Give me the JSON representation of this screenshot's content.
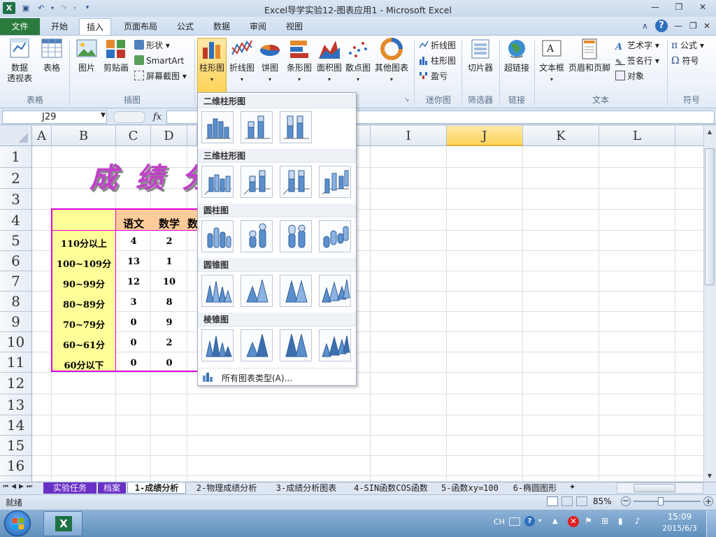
{
  "window": {
    "title": "Excel导学实验12-图表应用1 - Microsoft Excel"
  },
  "tabs": [
    "文件",
    "开始",
    "插入",
    "页面布局",
    "公式",
    "数据",
    "审阅",
    "视图"
  ],
  "ribbon": {
    "groups": {
      "table": {
        "label": "表格",
        "pivot_line1": "数据",
        "pivot_line2": "透视表",
        "table": "表格"
      },
      "illustrations": {
        "label": "插图",
        "picture": "图片",
        "clipart": "剪贴画",
        "shapes": "形状",
        "smartart": "SmartArt",
        "screenshot": "屏幕截图"
      },
      "charts": {
        "label": "",
        "column": "柱形图",
        "line": "折线图",
        "pie": "饼图",
        "bar": "条形图",
        "area": "面积图",
        "scatter": "散点图",
        "other": "其他图表"
      },
      "sparklines": {
        "label": "迷你图",
        "line": "折线图",
        "column": "柱形图",
        "winloss": "盈亏"
      },
      "filter": {
        "label": "筛选器",
        "slicer": "切片器"
      },
      "links": {
        "label": "链接",
        "hyperlink": "超链接"
      },
      "text": {
        "label": "文本",
        "textbox": "文本框",
        "headerfooter": "页眉和页脚",
        "wordart": "艺术字",
        "signature": "签名行",
        "object": "对象"
      },
      "symbols": {
        "label": "符号",
        "equation": "公式",
        "symbol": "符号"
      }
    }
  },
  "formula_bar": {
    "name_box": "J29",
    "fx": "fx",
    "value": ""
  },
  "columns": [
    "A",
    "B",
    "C",
    "D",
    "",
    "",
    "",
    "",
    "",
    "I",
    "J",
    "K",
    "L"
  ],
  "rows": [
    "1",
    "2",
    "3",
    "4",
    "5",
    "6",
    "7",
    "8",
    "9",
    "10",
    "11",
    "12",
    "13",
    "14",
    "15",
    "16"
  ],
  "sheet": {
    "title_art": "成 绩 分",
    "headers": [
      "语文",
      "数学",
      "数"
    ],
    "table": [
      {
        "label": "110分以上",
        "c": "4",
        "d": "2"
      },
      {
        "label": "100~109分",
        "c": "13",
        "d": "1"
      },
      {
        "label": "90~99分",
        "c": "12",
        "d": "10"
      },
      {
        "label": "80~89分",
        "c": "3",
        "d": "8"
      },
      {
        "label": "70~79分",
        "c": "0",
        "d": "9"
      },
      {
        "label": "60~61分",
        "c": "0",
        "d": "2"
      },
      {
        "label": "60分以下",
        "c": "0",
        "d": "0"
      }
    ]
  },
  "dropdown": {
    "sections": [
      "二维柱形图",
      "三维柱形图",
      "圆柱图",
      "圆锥图",
      "棱锥图"
    ],
    "all_types": "所有图表类型(A)..."
  },
  "sheet_tabs": [
    "实验任务",
    "档案",
    "1-成绩分析",
    "2-物理成绩分析",
    "3-成绩分析图表",
    "4-SIN函数COS函数",
    "5-函数xy=100",
    "6-椭圆图形"
  ],
  "status": {
    "ready": "就绪",
    "zoom": "85%"
  },
  "taskbar": {
    "lang": "CH",
    "time": "15:09",
    "date": "2015/6/3"
  },
  "colors": {
    "file_tab": "#2b7a3e",
    "title_art": "#c040c8",
    "table_border": "#e000e0",
    "table_fill": "#ffff99",
    "header_fill": "#ffcc99",
    "selected_col": "#ffd966"
  }
}
